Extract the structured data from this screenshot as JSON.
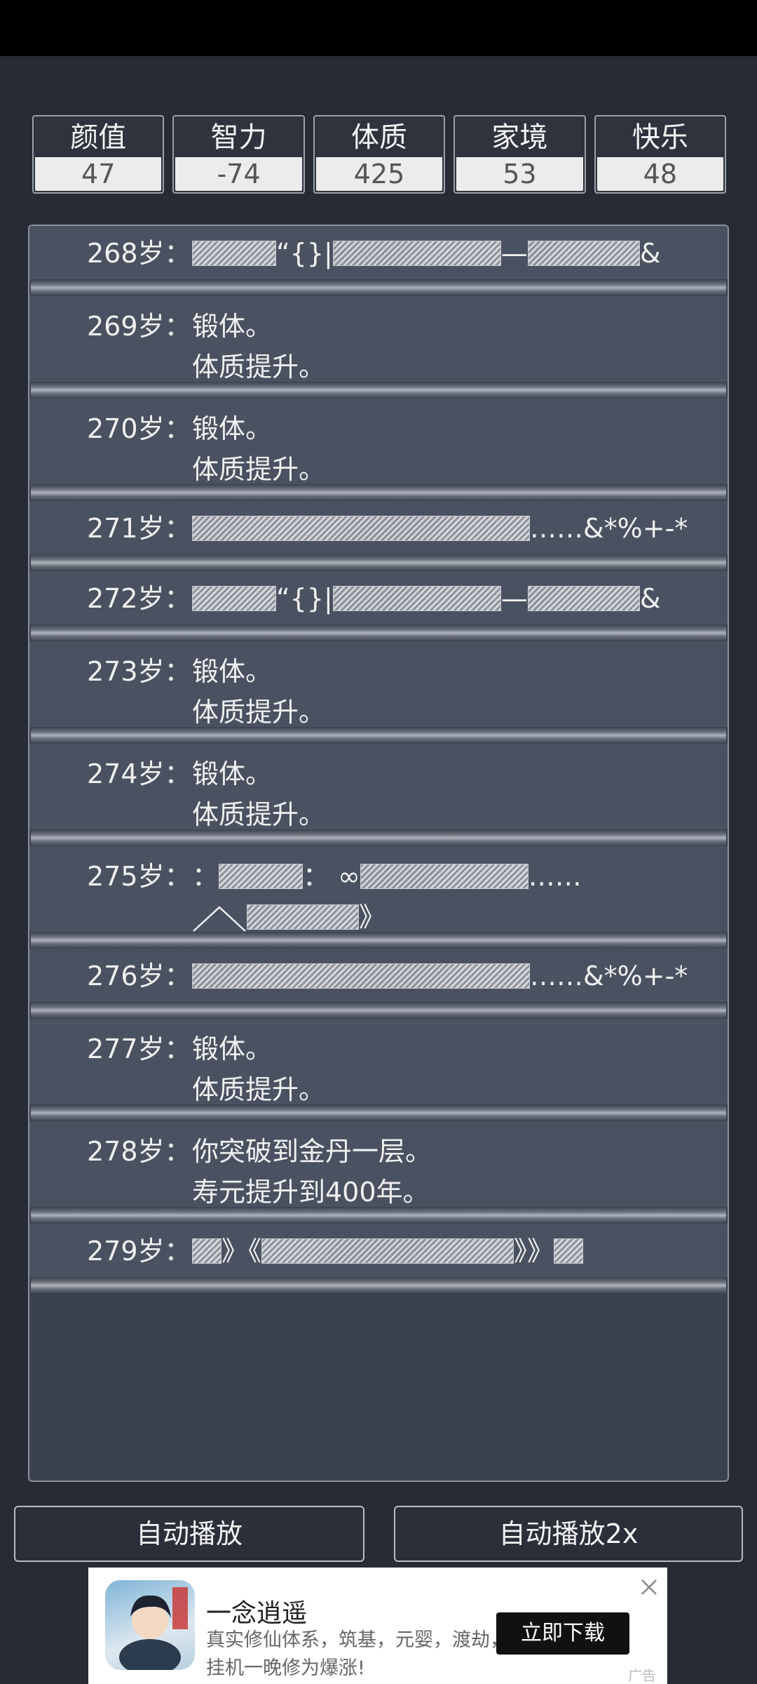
{
  "stats": [
    {
      "label": "颜值",
      "value": "47"
    },
    {
      "label": "智力",
      "value": "-74"
    },
    {
      "label": "体质",
      "value": "425"
    },
    {
      "label": "家境",
      "value": "53"
    },
    {
      "label": "快乐",
      "value": "48"
    }
  ],
  "log": [
    {
      "age": "268岁：",
      "lines": [
        [
          [
            "g",
            120
          ],
          [
            "t",
            "“{}|"
          ],
          [
            "g",
            240
          ],
          [
            "t",
            "—"
          ],
          [
            "g",
            160
          ],
          [
            "t",
            "&"
          ]
        ]
      ]
    },
    {
      "age": "269岁：",
      "lines": [
        [
          [
            "t",
            "锻体。"
          ]
        ],
        [
          [
            "t",
            "体质提升。"
          ]
        ]
      ]
    },
    {
      "age": "270岁：",
      "lines": [
        [
          [
            "t",
            "锻体。"
          ]
        ],
        [
          [
            "t",
            "体质提升。"
          ]
        ]
      ]
    },
    {
      "age": "271岁：",
      "lines": [
        [
          [
            "g",
            482
          ],
          [
            "t",
            "……&*%+-*"
          ]
        ]
      ]
    },
    {
      "age": "272岁：",
      "lines": [
        [
          [
            "g",
            120
          ],
          [
            "t",
            "“{}|"
          ],
          [
            "g",
            240
          ],
          [
            "t",
            "—"
          ],
          [
            "g",
            160
          ],
          [
            "t",
            "&"
          ]
        ]
      ]
    },
    {
      "age": "273岁：",
      "lines": [
        [
          [
            "t",
            "锻体。"
          ]
        ],
        [
          [
            "t",
            "体质提升。"
          ]
        ]
      ]
    },
    {
      "age": "274岁：",
      "lines": [
        [
          [
            "t",
            "锻体。"
          ]
        ],
        [
          [
            "t",
            "体质提升。"
          ]
        ]
      ]
    },
    {
      "age": "275岁：",
      "lines": [
        [
          [
            "t",
            "："
          ],
          [
            "g",
            120
          ],
          [
            "t",
            "： ∞"
          ],
          [
            "g",
            240
          ],
          [
            "t",
            "……"
          ]
        ],
        [
          [
            "c",
            0
          ],
          [
            "g",
            160
          ],
          [
            "t",
            "》"
          ]
        ]
      ]
    },
    {
      "age": "276岁：",
      "lines": [
        [
          [
            "g",
            482
          ],
          [
            "t",
            "……&*%+-*"
          ]
        ]
      ]
    },
    {
      "age": "277岁：",
      "lines": [
        [
          [
            "t",
            "锻体。"
          ]
        ],
        [
          [
            "t",
            "体质提升。"
          ]
        ]
      ]
    },
    {
      "age": "278岁：",
      "lines": [
        [
          [
            "t",
            "你突破到金丹一层。"
          ]
        ],
        [
          [
            "t",
            "寿元提升到400年。"
          ]
        ]
      ]
    },
    {
      "age": "279岁：",
      "lines": [
        [
          [
            "g",
            42
          ],
          [
            "t",
            "》《"
          ],
          [
            "g",
            360
          ],
          [
            "t",
            "》》"
          ],
          [
            "g",
            42
          ]
        ]
      ]
    }
  ],
  "buttons": {
    "auto_play": "自动播放",
    "auto_play_2x": "自动播放2x"
  },
  "ad": {
    "title": "一念逍遥",
    "description": "真实修仙体系，筑基，元婴，渡劫，飞升，挂机一晚修为爆涨!",
    "cta": "立即下载",
    "badge": "广告"
  }
}
